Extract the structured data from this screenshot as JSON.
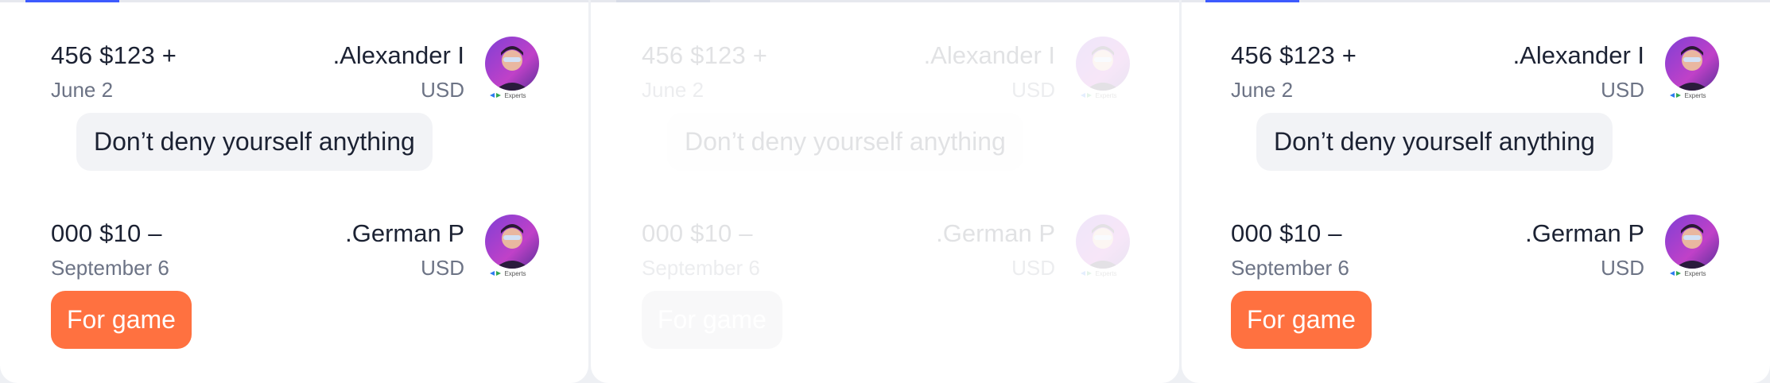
{
  "panels": [
    {
      "transactions": [
        {
          "amount": "456 $123 +",
          "name": ".Alexander I",
          "date": "June 2",
          "currency": "USD",
          "note": "Don’t deny yourself anything",
          "avatar_icon": "user-avatar-icon",
          "avatar_badge": "Experts"
        },
        {
          "amount": "000 $10 –",
          "name": ".German P",
          "date": "September 6",
          "currency": "USD",
          "tag": "For game",
          "avatar_icon": "user-avatar-icon",
          "avatar_badge": "Experts"
        }
      ]
    },
    {
      "transactions": [
        {
          "amount": "456 $123 +",
          "name": ".Alexander I",
          "date": "June 2",
          "currency": "USD",
          "note": "Don’t deny yourself anything",
          "avatar_icon": "user-avatar-icon",
          "avatar_badge": "Experts"
        },
        {
          "amount": "000 $10 –",
          "name": ".German P",
          "date": "September 6",
          "currency": "USD",
          "tag": "For game",
          "avatar_icon": "user-avatar-icon",
          "avatar_badge": "Experts"
        }
      ]
    },
    {
      "transactions": [
        {
          "amount": "456 $123 +",
          "name": ".Alexander I",
          "date": "June 2",
          "currency": "USD",
          "note": "Don’t deny yourself anything",
          "avatar_icon": "user-avatar-icon",
          "avatar_badge": "Experts"
        },
        {
          "amount": "000 $10 –",
          "name": ".German P",
          "date": "September 6",
          "currency": "USD",
          "tag": "For game",
          "avatar_icon": "user-avatar-icon",
          "avatar_badge": "Experts"
        }
      ]
    }
  ],
  "colors": {
    "accent": "#3d5afe",
    "tag_bg": "#ff7140",
    "note_bg": "#f2f3f6",
    "text_primary": "#1c2233",
    "text_secondary": "#6c7385"
  }
}
